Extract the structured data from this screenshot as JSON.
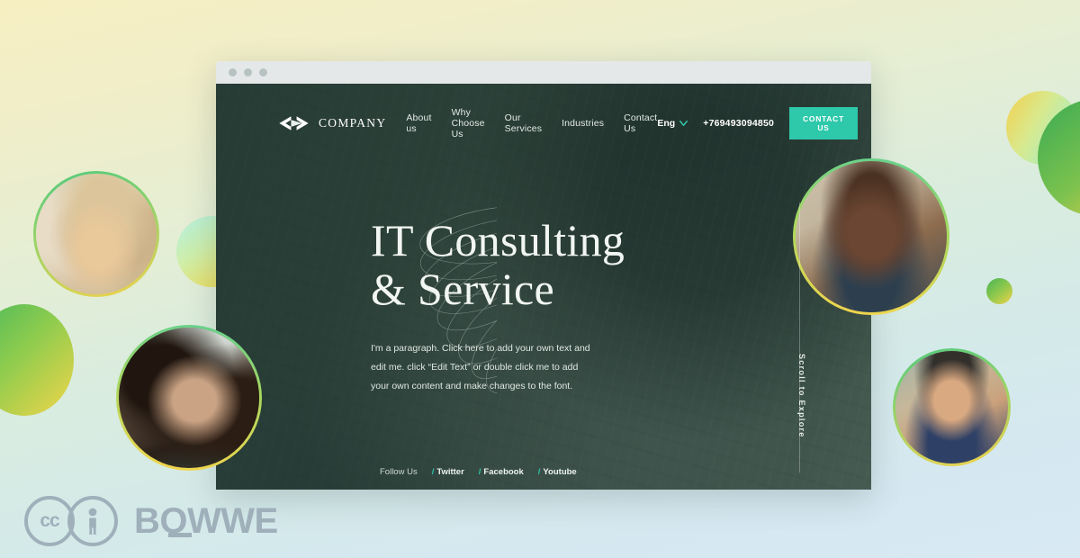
{
  "background": {
    "top_color": "#f6efc2",
    "bottom_color": "#d8e9f3",
    "accent_green": "#4cba5a",
    "accent_yellow": "#f2d54a",
    "accent_teal": "#2ec8ab"
  },
  "browser": {
    "dots": [
      "dot-1",
      "dot-2",
      "dot-3"
    ]
  },
  "site": {
    "nav": {
      "brand_name": "COMPANY",
      "logo_icon": "chevron-logo-icon",
      "links": [
        {
          "label": "About us"
        },
        {
          "label": "Why Choose Us"
        },
        {
          "label": "Our Services"
        },
        {
          "label": "Industries"
        },
        {
          "label": "Contact Us"
        }
      ],
      "language": "Eng",
      "language_icon": "chevron-down-icon",
      "phone": "+769493094850",
      "cta_label": "CONTACT US"
    },
    "hero": {
      "title_line1": "IT Consulting",
      "title_line2": "& Service",
      "paragraph": "I'm a paragraph. Click here to add your own text and edit me. click “Edit Text” or double click me to add your own content and make changes to the font."
    },
    "scroll_hint": "Scroll to Explore",
    "footer": {
      "follow_label": "Follow Us",
      "links": [
        {
          "separator": "/",
          "label": "Twitter"
        },
        {
          "separator": "/",
          "label": "Facebook"
        },
        {
          "separator": "/",
          "label": "Youtube"
        }
      ]
    }
  },
  "avatars": [
    {
      "name": "avatar-woman-blonde"
    },
    {
      "name": "avatar-man-beard"
    },
    {
      "name": "avatar-woman-laughing"
    },
    {
      "name": "avatar-man-cap"
    }
  ],
  "badge": {
    "cc_label": "cc",
    "by_icon": "person-icon",
    "wordmark": "BOWWE"
  }
}
